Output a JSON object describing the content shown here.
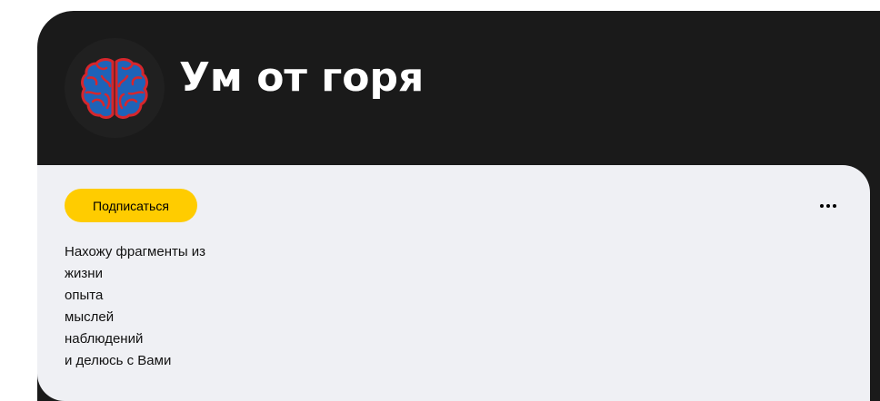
{
  "channel": {
    "title": "Ум от горя",
    "avatar_icon": "brain-icon"
  },
  "actions": {
    "subscribe_label": "Подписаться",
    "more_icon": "more-dots-icon"
  },
  "description": {
    "lines": [
      "Нахожу фрагменты из",
      "жизни",
      "опыта",
      "мыслей",
      "наблюдений",
      "и делюсь с Вами"
    ]
  },
  "colors": {
    "header_bg": "#1a1a1a",
    "body_bg": "#eff0f4",
    "accent": "#ffcc00",
    "brain_fill": "#1e63b8",
    "brain_outline": "#d6262c"
  }
}
